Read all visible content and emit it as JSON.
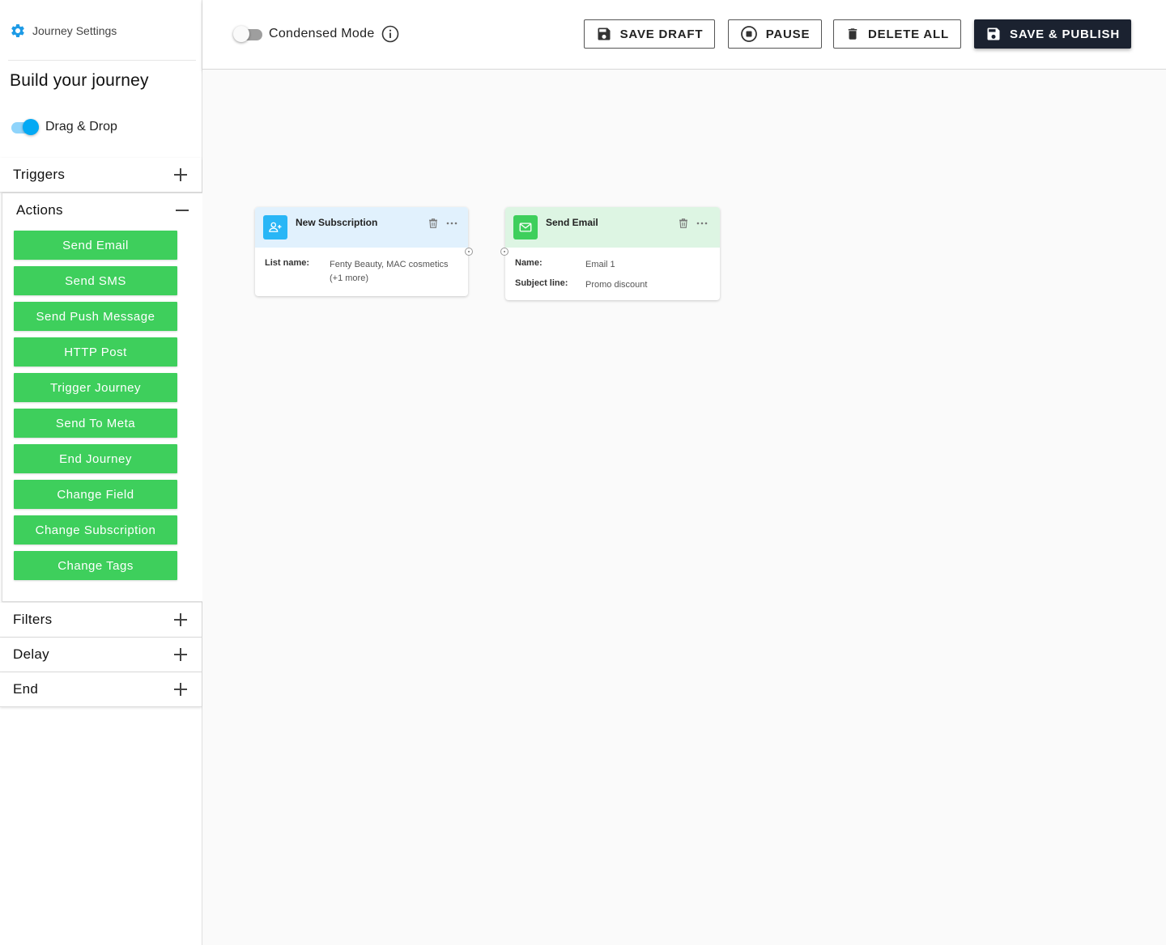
{
  "sidebar": {
    "settings_label": "Journey Settings",
    "title": "Build your journey",
    "drag_drop_label": "Drag & Drop",
    "sections": {
      "triggers": "Triggers",
      "actions": "Actions",
      "filters": "Filters",
      "delay": "Delay",
      "end": "End"
    },
    "actions": [
      "Send Email",
      "Send SMS",
      "Send Push Message",
      "HTTP Post",
      "Trigger Journey",
      "Send To Meta",
      "End Journey",
      "Change Field",
      "Change Subscription",
      "Change Tags"
    ]
  },
  "toolbar": {
    "condensed_mode_label": "Condensed Mode",
    "save_draft": "SAVE DRAFT",
    "pause": "PAUSE",
    "delete_all": "DELETE ALL",
    "save_publish": "SAVE & PUBLISH"
  },
  "nodes": {
    "subscription": {
      "title": "New Subscription",
      "list_name_label": "List name:",
      "list_name_value": "Fenty Beauty, MAC cosmetics (+1 more)"
    },
    "email": {
      "title": "Send Email",
      "name_label": "Name:",
      "name_value": "Email 1",
      "subject_label": "Subject line:",
      "subject_value": "Promo discount"
    }
  },
  "colors": {
    "action_green": "#3ecf5c",
    "accent_blue": "#03a9f4",
    "publish_dark": "#1b2230",
    "trigger_header": "#e1f1fd",
    "action_header": "#ddf5e3"
  }
}
